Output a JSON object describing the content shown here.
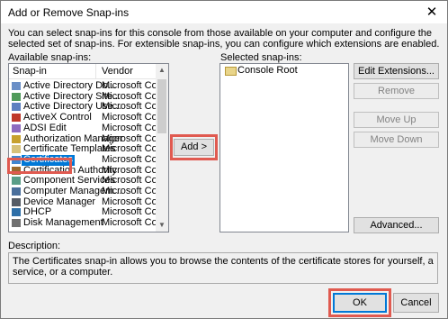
{
  "window": {
    "title": "Add or Remove Snap-ins",
    "close_glyph": "✕"
  },
  "intro_text": "You can select snap-ins for this console from those available on your computer and configure the selected set of snap-ins. For extensible snap-ins, you can configure which extensions are enabled.",
  "available": {
    "label": "Available snap-ins:",
    "columns": {
      "snapin": "Snap-in",
      "vendor": "Vendor"
    },
    "items": [
      {
        "name": "Active Directory Do...",
        "vendor": "Microsoft Cor...",
        "icon": "domain-icon"
      },
      {
        "name": "Active Directory Site...",
        "vendor": "Microsoft Cor...",
        "icon": "sites-icon"
      },
      {
        "name": "Active Directory Use...",
        "vendor": "Microsoft Cor...",
        "icon": "users-icon"
      },
      {
        "name": "ActiveX Control",
        "vendor": "Microsoft Cor...",
        "icon": "activex-icon"
      },
      {
        "name": "ADSI Edit",
        "vendor": "Microsoft Cor...",
        "icon": "adsi-icon"
      },
      {
        "name": "Authorization Manager",
        "vendor": "Microsoft Cor...",
        "icon": "authorization-icon"
      },
      {
        "name": "Certificate Templates",
        "vendor": "Microsoft Cor...",
        "icon": "template-icon"
      },
      {
        "name": "Certificates",
        "vendor": "Microsoft Cor...",
        "icon": "certificate-icon"
      },
      {
        "name": "Certification Authority",
        "vendor": "Microsoft Cor...",
        "icon": "ca-icon"
      },
      {
        "name": "Component Services",
        "vendor": "Microsoft Cor...",
        "icon": "component-icon"
      },
      {
        "name": "Computer Managem...",
        "vendor": "Microsoft Cor...",
        "icon": "computer-icon"
      },
      {
        "name": "Device Manager",
        "vendor": "Microsoft Cor...",
        "icon": "device-icon"
      },
      {
        "name": "DHCP",
        "vendor": "Microsoft Cor...",
        "icon": "dhcp-icon"
      },
      {
        "name": "Disk Management",
        "vendor": "Microsoft Cor...",
        "icon": "disk-icon"
      }
    ],
    "selected_index": 7
  },
  "add_button": "Add >",
  "selected": {
    "label": "Selected snap-ins:",
    "items": [
      "Console Root"
    ]
  },
  "side_buttons": {
    "edit_extensions": "Edit Extensions...",
    "remove": "Remove",
    "move_up": "Move Up",
    "move_down": "Move Down",
    "advanced": "Advanced..."
  },
  "description": {
    "label": "Description:",
    "text": "The Certificates snap-in allows you to browse the contents of the certificate stores for yourself, a service, or a computer."
  },
  "footer": {
    "ok": "OK",
    "cancel": "Cancel"
  },
  "colors": {
    "selection": "#0078d7",
    "highlight_box": "#e05a50"
  }
}
